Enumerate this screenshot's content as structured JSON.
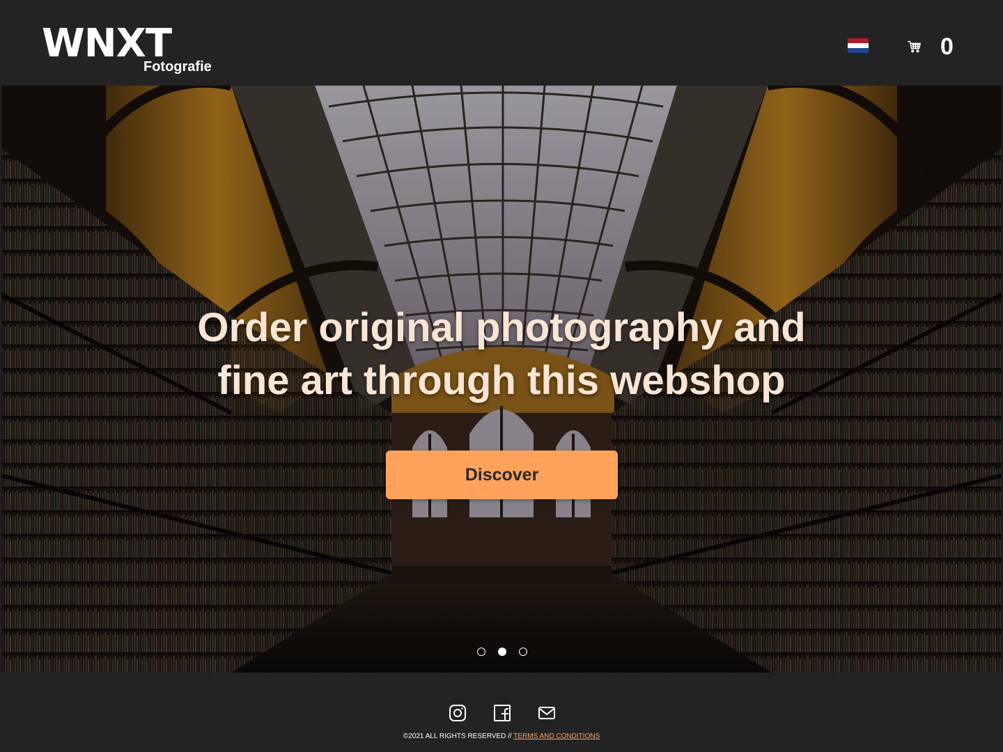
{
  "header": {
    "logo_main": "WNXT",
    "logo_sub": "Fotografie",
    "language_flag": {
      "icon": "netherlands-flag-icon",
      "colors": [
        "#ae1c28",
        "#ffffff",
        "#21468b"
      ]
    },
    "cart": {
      "icon": "shopping-cart-icon",
      "count": "0"
    }
  },
  "hero": {
    "background": "library-interior-photo",
    "headline_line1": "Order original photography and",
    "headline_line2": "fine art through this webshop",
    "cta_label": "Discover",
    "slides_total": 3,
    "active_slide": 2
  },
  "footer": {
    "social_icons": [
      "instagram-icon",
      "facebook-icon",
      "mail-icon"
    ],
    "copyright": "©2021 ALL RIGHTS RESERVED // ",
    "terms_label": "TERMS AND CONDITIONS"
  },
  "colors": {
    "background": "#232323",
    "accent": "#ffa35c",
    "headline": "#f8e5d4"
  }
}
